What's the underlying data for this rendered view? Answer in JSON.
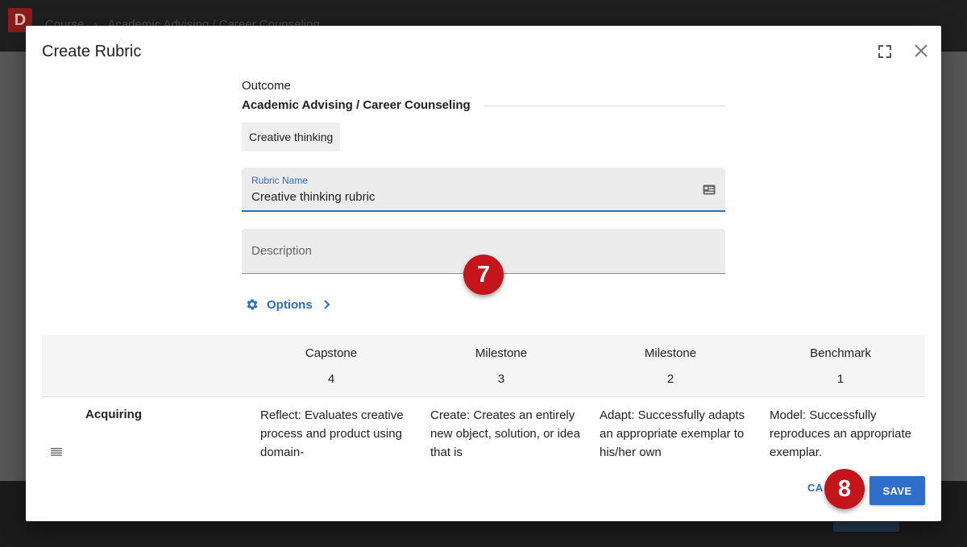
{
  "background": {
    "logo_letter": "D",
    "breadcrumb": [
      "Course",
      "Academic Advising / Career Counseling"
    ],
    "breadcrumb_separator": "›"
  },
  "dialog": {
    "title": "Create Rubric",
    "icons": [
      "fullscreen-icon",
      "close-icon"
    ],
    "outcome_label": "Outcome",
    "outcome_value": "Academic Advising / Career Counseling",
    "chip_label": "Creative thinking",
    "rubric_name": {
      "label": "Rubric Name",
      "value": "Creative thinking rubric"
    },
    "description": {
      "placeholder": "Description"
    },
    "options_label": "Options",
    "callouts": [
      "7",
      "8"
    ],
    "rubric": {
      "levels": [
        {
          "name": "Capstone",
          "points": "4"
        },
        {
          "name": "Milestone",
          "points": "3"
        },
        {
          "name": "Milestone",
          "points": "2"
        },
        {
          "name": "Benchmark",
          "points": "1"
        }
      ],
      "criteria": [
        {
          "name": "Acquiring",
          "cells": [
            "Reflect: Evaluates creative process and product using domain-",
            "Create: Creates an entirely new object, solution, or idea that is",
            "Adapt: Successfully adapts an appropriate exemplar to his/her own",
            "Model: Successfully reproduces an appropriate exemplar."
          ]
        }
      ]
    },
    "cancel_label": "CA",
    "save_label": "SAVE"
  },
  "colors": {
    "accent": "#2b6cc4",
    "save_button": "#2f6fcb",
    "callout": "#c4141c",
    "overlay": "#5a5a5a"
  }
}
